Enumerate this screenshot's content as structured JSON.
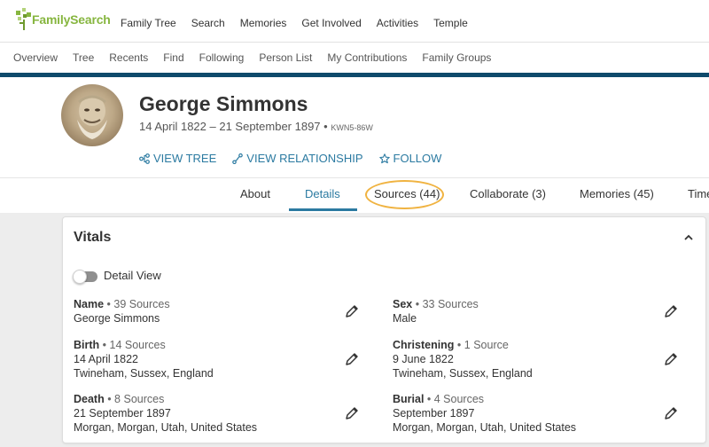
{
  "brand": {
    "name": "FamilySearch"
  },
  "top_nav": [
    "Family Tree",
    "Search",
    "Memories",
    "Get Involved",
    "Activities",
    "Temple"
  ],
  "sub_nav": [
    "Overview",
    "Tree",
    "Recents",
    "Find",
    "Following",
    "Person List",
    "My Contributions",
    "Family Groups"
  ],
  "person": {
    "name": "George Simmons",
    "dates": "14 April 1822 – 21 September 1897 •",
    "pid": "KWN5-86W"
  },
  "actions": {
    "view_tree": "VIEW TREE",
    "view_relationship": "VIEW RELATIONSHIP",
    "follow": "FOLLOW"
  },
  "tabs": [
    {
      "label": "About"
    },
    {
      "label": "Details"
    },
    {
      "label": "Sources (44)"
    },
    {
      "label": "Collaborate (3)"
    },
    {
      "label": "Memories (45)"
    },
    {
      "label": "Time"
    }
  ],
  "vitals": {
    "title": "Vitals",
    "detail_view": "Detail View",
    "name": {
      "label": "Name",
      "sources": " • 39 Sources",
      "line1": "George Simmons"
    },
    "sex": {
      "label": "Sex",
      "sources": " • 33 Sources",
      "line1": "Male"
    },
    "birth": {
      "label": "Birth",
      "sources": " • 14 Sources",
      "line1": "14 April 1822",
      "line2": "Twineham, Sussex, England"
    },
    "christening": {
      "label": "Christening",
      "sources": " • 1 Source",
      "line1": "9 June 1822",
      "line2": "Twineham, Sussex, England"
    },
    "death": {
      "label": "Death",
      "sources": " • 8 Sources",
      "line1": "21 September 1897",
      "line2": "Morgan, Morgan, Utah, United States"
    },
    "burial": {
      "label": "Burial",
      "sources": " • 4 Sources",
      "line1": "September 1897",
      "line2": "Morgan, Morgan, Utah, United States"
    }
  },
  "colors": {
    "brand_green": "#87b640",
    "link_blue": "#2b7aa1",
    "header_band": "#0e4a6b",
    "highlight": "#f0b341"
  }
}
